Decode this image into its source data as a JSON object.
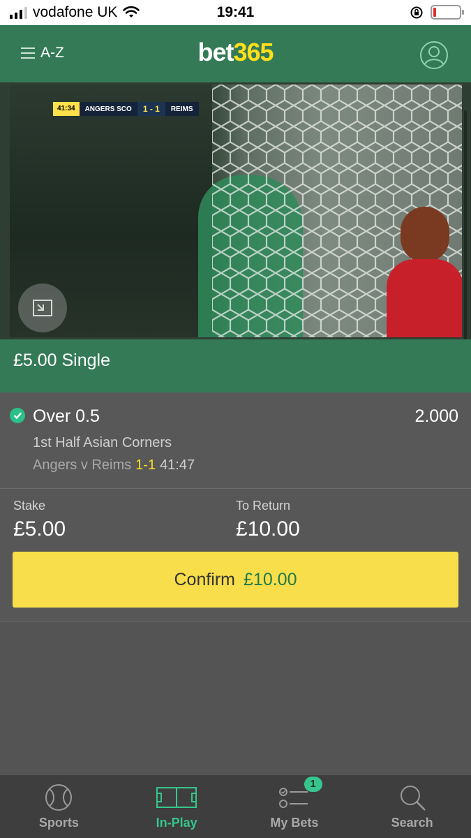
{
  "status_bar": {
    "carrier": "vodafone UK",
    "time": "19:41",
    "battery_level": 0.1
  },
  "header": {
    "menu_label": "A-Z",
    "brand_part1": "bet",
    "brand_part2": "365",
    "icons": [
      "menu-icon",
      "account-icon"
    ]
  },
  "video": {
    "scorebug": {
      "clock": "41:34",
      "home": "ANGERS SCO",
      "score": "1 - 1",
      "away": "REIMS"
    },
    "control_icon": "minimize-video-icon"
  },
  "betslip": {
    "title": "£5.00 Single",
    "selection": {
      "name": "Over 0.5",
      "odds": "2.000",
      "market": "1st Half Asian Corners",
      "fixture": "Angers v Reims",
      "score": "1-1",
      "clock": "41:47"
    },
    "stake_label": "Stake",
    "stake_value": "£5.00",
    "return_label": "To Return",
    "return_value": "£10.00",
    "confirm_label": "Confirm",
    "confirm_amount": "£10.00"
  },
  "bottom_nav": {
    "items": [
      {
        "label": "Sports",
        "icon": "ball-icon"
      },
      {
        "label": "In-Play",
        "icon": "pitch-icon",
        "active": true
      },
      {
        "label": "My Bets",
        "icon": "bets-list-icon",
        "badge": "1"
      },
      {
        "label": "Search",
        "icon": "search-icon"
      }
    ]
  },
  "colors": {
    "header_green": "#347a57",
    "brand_yellow": "#ffdf1b",
    "confirm_yellow": "#f7de4a",
    "active_green": "#37c58d"
  }
}
